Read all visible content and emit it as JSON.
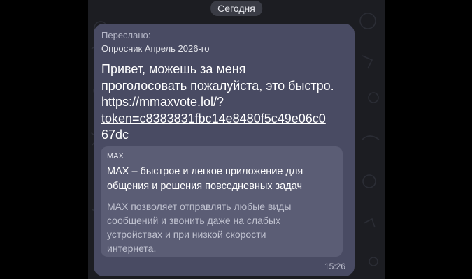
{
  "chat": {
    "date_divider": "Сегодня"
  },
  "message": {
    "forwarded_label": "Переслано:",
    "forwarded_from": "Опросник Апрель 2026-го",
    "text_lines": [
      "Привет, можешь за меня",
      "проголосовать пожалуйста, это быстро."
    ],
    "link_lines": [
      "https://mmaxvote.lol/?",
      "token=c8383831fbc14e8480f5c49e06c0",
      "67dc"
    ],
    "time": "15:26",
    "preview": {
      "site_name": "MAX",
      "title_lines": [
        "MAX – быстрое и легкое приложение для",
        "общения и решения повседневных задач"
      ],
      "description_lines": [
        "MAX позволяет отправлять любые виды",
        "сообщений и звонить даже на слабых",
        "устройствах и при низкой скорости",
        "интернета."
      ]
    }
  },
  "colors": {
    "page_background": "#000000",
    "chat_background": "#1c1d22",
    "bubble": "#494b63",
    "preview_card": "#5b5d75",
    "date_pill": "#3a3c45"
  }
}
